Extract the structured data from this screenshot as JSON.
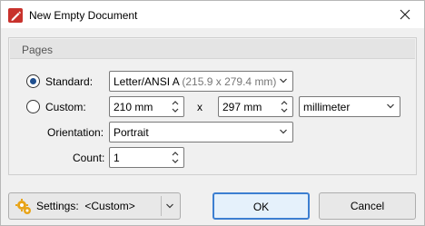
{
  "window": {
    "title": "New Empty Document"
  },
  "pages_group": {
    "title": "Pages"
  },
  "standard": {
    "label": "Standard:",
    "selected": true,
    "value_main": "Letter/ANSI A",
    "value_dim": " (215.9 x 279.4 mm)"
  },
  "custom": {
    "label": "Custom:",
    "selected": false,
    "width": "210 mm",
    "separator": "x",
    "height": "297 mm",
    "unit": "millimeter"
  },
  "orientation": {
    "label": "Orientation:",
    "value": "Portrait"
  },
  "count": {
    "label": "Count:",
    "value": "1"
  },
  "footer": {
    "settings_label": "Settings:",
    "settings_value": "<Custom>",
    "ok_label": "OK",
    "cancel_label": "Cancel"
  },
  "icons": {
    "app": "pdf-pen-icon",
    "close": "close-icon",
    "settings": "gears-icon",
    "chevron": "chevron-down-icon",
    "spin": "spin-arrows-icon"
  },
  "colors": {
    "app_icon": "#c8322c",
    "radio_dot": "#1f4f8f",
    "ok_border": "#3c7fd1",
    "settings_gear": "#e8a418"
  }
}
